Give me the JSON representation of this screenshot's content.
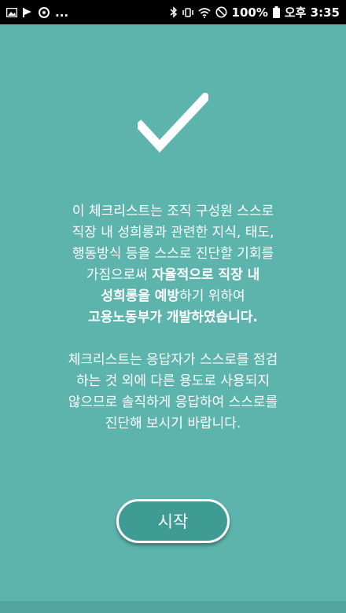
{
  "status_bar": {
    "more_indicator": "...",
    "battery_percent": "100%",
    "time": "오후 3:35"
  },
  "intro": {
    "line1": "이 체크리스트는 조직 구성원 스스로",
    "line2": "직장 내 성희롱과 관련한 지식, 태도,",
    "line3": "행동방식 등을 스스로 진단할 기회를",
    "line4_normal": "가짐으로써 ",
    "line4_bold": "자율적으로 직장 내",
    "line5_bold": "성희롱을 예방",
    "line5_normal": "하기 위하여",
    "line6": "고용노동부가 개발하였습니다.",
    "line7": "체크리스트는 응답자가 스스로를 점검",
    "line8": "하는 것 외에 다른 용도로 사용되지",
    "line9": "않으므로 솔직하게 응답하여 스스로를",
    "line10": "진단해 보시기 바랍니다."
  },
  "start_button": {
    "label": "시작"
  },
  "icons": [
    "gallery-icon",
    "flag-icon",
    "sync-icon",
    "bluetooth-icon",
    "vibrate-icon",
    "wifi-icon",
    "do-not-disturb-icon",
    "battery-icon",
    "checkmark-icon"
  ]
}
